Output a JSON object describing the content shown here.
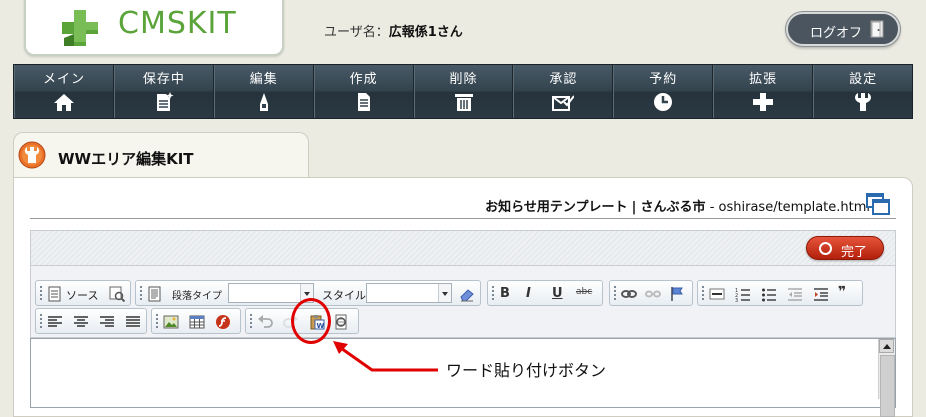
{
  "app": {
    "logo_text": "CMSKIT",
    "brand_color": "#5aa43a"
  },
  "user": {
    "label": "ユーザ名：",
    "name": "広報係1さん"
  },
  "logoff": {
    "label": "ログオフ"
  },
  "menu": {
    "items": [
      {
        "label": "メイン",
        "icon": "home-icon"
      },
      {
        "label": "保存中",
        "icon": "saved-document-icon"
      },
      {
        "label": "編集",
        "icon": "pencil-icon"
      },
      {
        "label": "作成",
        "icon": "document-icon"
      },
      {
        "label": "削除",
        "icon": "trash-icon"
      },
      {
        "label": "承認",
        "icon": "approve-mail-icon"
      },
      {
        "label": "予約",
        "icon": "clock-icon"
      },
      {
        "label": "拡張",
        "icon": "plus-icon"
      },
      {
        "label": "設定",
        "icon": "wrench-icon"
      }
    ]
  },
  "tab": {
    "title": "WWエリア編集KIT",
    "icon": "wrench-icon"
  },
  "page": {
    "template_name": "お知らせ用テンプレート",
    "separator": "|",
    "site_name": "さんぶる市",
    "dash": "-",
    "file_path": "oshirase/template.html"
  },
  "editor": {
    "done_label": "完了",
    "done_color": "#c52b12",
    "toolbar": {
      "source_label": "ソース",
      "format_label": "段落タイプ",
      "format_value": "",
      "style_label": "スタイル",
      "style_value": "",
      "bold_label": "B",
      "italic_label": "I",
      "underline_label": "U",
      "strike_label": "abc",
      "quote_label": "❞"
    }
  },
  "annotation": {
    "text": "ワード貼り付けボタン",
    "color": "#e00000"
  }
}
